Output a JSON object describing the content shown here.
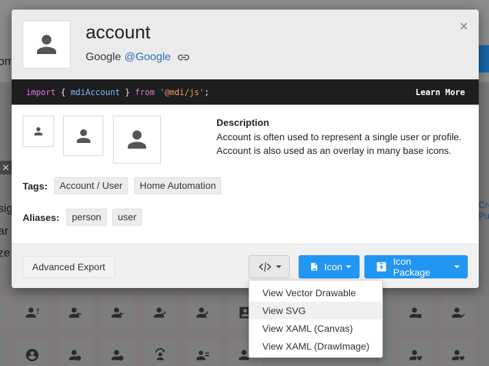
{
  "background": {
    "text_left": [
      "om",
      "sig",
      "ar",
      "ze"
    ],
    "links_right": [
      "Cre",
      "Pu"
    ]
  },
  "modal": {
    "title": "account",
    "author": "Google",
    "author_handle": "@Google",
    "code": {
      "import_kw": "import",
      "open_brace": "{",
      "identifier": "mdiAccount",
      "close_brace": "}",
      "from_kw": "from",
      "module": "'@mdi/js'",
      "semicolon": ";"
    },
    "learn_more": "Learn More",
    "description_title": "Description",
    "description_line1": "Account is often used to represent a single user or profile.",
    "description_line2": "Account is also used as an overlay in many base icons.",
    "tags_label": "Tags:",
    "tags": [
      "Account / User",
      "Home Automation"
    ],
    "aliases_label": "Aliases:",
    "aliases": [
      "person",
      "user"
    ],
    "footer": {
      "advanced_export": "Advanced Export",
      "icon_button": "Icon",
      "icon_package_button": "Icon Package"
    },
    "dropdown": {
      "items": [
        "View Vector Drawable",
        "View SVG",
        "View XAML (Canvas)",
        "View XAML (DrawImage)"
      ],
      "active_index": 1
    }
  },
  "colors": {
    "primary": "#2196f3",
    "code_bg": "#1e1e1e",
    "header_bg": "#ebebeb",
    "link": "#2a6fb5"
  }
}
